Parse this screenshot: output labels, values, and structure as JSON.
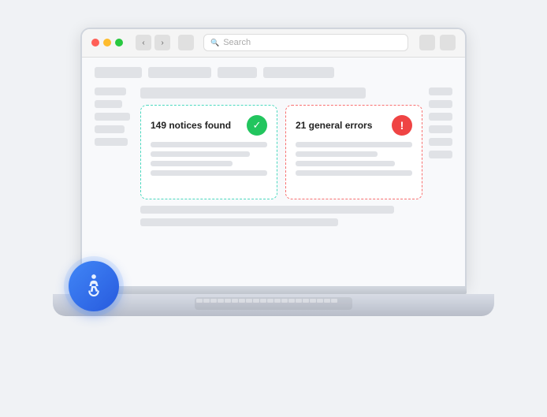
{
  "browser": {
    "dots": [
      "red",
      "yellow",
      "green"
    ],
    "search_placeholder": "Search",
    "cards": [
      {
        "id": "notices",
        "title": "149 notices found",
        "icon_type": "check",
        "border_color": "#4dd9c0"
      },
      {
        "id": "errors",
        "title": "21 general errors",
        "icon_type": "error",
        "border_color": "#f87171"
      }
    ]
  },
  "accessibility_button": {
    "label": "Accessibility options",
    "icon": "accessibility"
  }
}
